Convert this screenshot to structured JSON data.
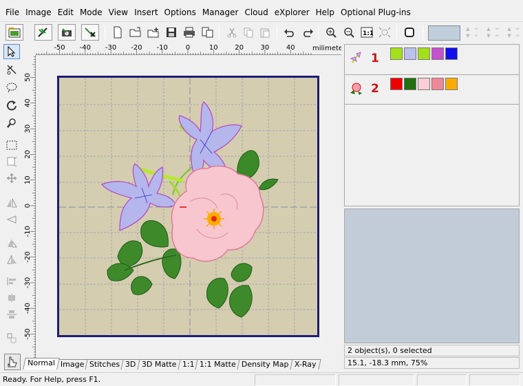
{
  "menu": [
    "File",
    "Image",
    "Edit",
    "Mode",
    "View",
    "Insert",
    "Options",
    "Manager",
    "Cloud",
    "eXplorer",
    "Help",
    "Optional Plug-ins"
  ],
  "toolbar": {
    "icons": [
      "open-design-icon",
      "stitch-design-icon",
      "photo-capture-icon",
      "delete-stitch-icon",
      "new-file-icon",
      "open-folder-icon",
      "add-design-icon",
      "save-icon",
      "print-icon",
      "print-preview-icon",
      "cut-icon",
      "copy-icon",
      "paste-icon",
      "undo-icon",
      "redo-icon",
      "zoom-in-icon",
      "zoom-out-icon",
      "actual-size-icon",
      "zoom-fit-icon",
      "stop-icon"
    ],
    "thread_color": "#c1cedb"
  },
  "ruler": {
    "unit": "milimeters",
    "h_labels": [
      "-50",
      "-40",
      "-30",
      "-20",
      "-10",
      "0",
      "10",
      "20",
      "30",
      "40"
    ],
    "v_labels": [
      "50",
      "40",
      "30",
      "20",
      "10",
      "0",
      "-10",
      "-20",
      "-30",
      "-40",
      "-50"
    ]
  },
  "tabs": [
    "Normal",
    "Image",
    "Stitches",
    "3D",
    "3D Matte",
    "1:1",
    "1:1 Matte",
    "Density Map",
    "X-Ray"
  ],
  "active_tab": "Normal",
  "objects": [
    {
      "number": "1",
      "colors": [
        "#a4e01a",
        "#bcc0ec",
        "#a4e01a",
        "#c452cc",
        "#0f0ff0"
      ]
    },
    {
      "number": "2",
      "colors": [
        "#ee0000",
        "#207010",
        "#fbcdd6",
        "#ee8898",
        "#fcac00"
      ]
    }
  ],
  "info": {
    "selection": "2 object(s), 0 selected",
    "coords": "15.1, -18.3 mm, 75%"
  },
  "status": {
    "message": "Ready. For Help, press F1."
  },
  "colors": {
    "hoop_fabric": "#d5cdb0",
    "hoop_border": "#1c1c78",
    "preview_bg": "#c1ccd8",
    "number_red": "#d01010"
  }
}
